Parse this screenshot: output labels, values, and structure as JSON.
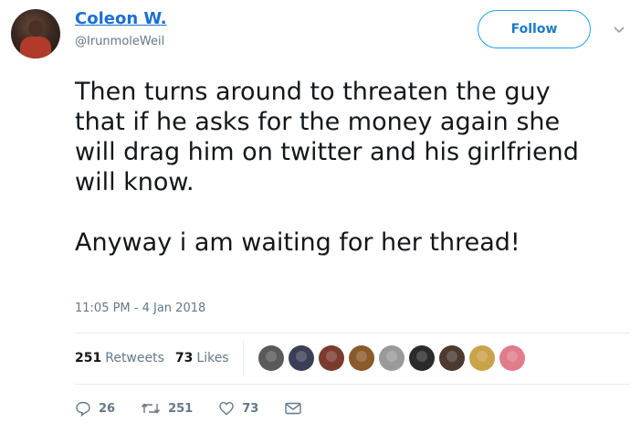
{
  "author": {
    "name": "Coleon W.",
    "handle": "@IrunmoleWeil"
  },
  "follow_button": {
    "label": "Follow"
  },
  "tweet": {
    "text": "Then turns around to threaten the guy\nthat if he asks for the money again she\nwill drag him on twitter and his girlfriend\nwill know.\n\nAnyway i am waiting for her thread!",
    "timestamp": "11:05 PM - 4 Jan 2018"
  },
  "stats": {
    "retweets_count": "251",
    "retweets_label": "Retweets",
    "likes_count": "73",
    "likes_label": "Likes"
  },
  "likers": [
    {
      "color": "#5a5a5a"
    },
    {
      "color": "#3a3f55"
    },
    {
      "color": "#7a3b2e"
    },
    {
      "color": "#8a5a2b"
    },
    {
      "color": "#9a9a9a"
    },
    {
      "color": "#2b2b2b"
    },
    {
      "color": "#4a3a30"
    },
    {
      "color": "#c9a24a"
    },
    {
      "color": "#e27b8a"
    }
  ],
  "actions": {
    "replies": "26",
    "retweets": "251",
    "likes": "73"
  },
  "icons": [
    "reply-icon",
    "retweet-icon",
    "like-icon",
    "message-icon",
    "chevron-down-icon"
  ]
}
